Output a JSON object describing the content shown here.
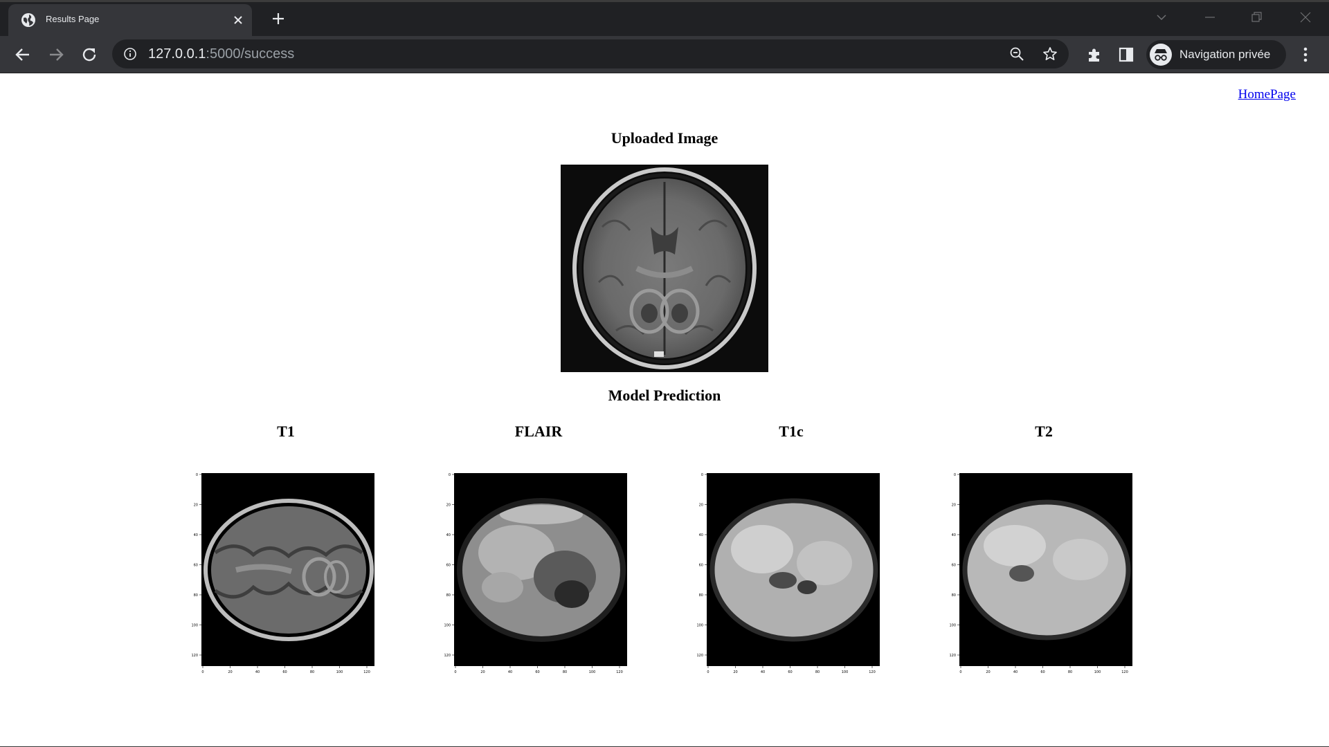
{
  "browser": {
    "tab_title": "Results Page",
    "url_host": "127.0.0.1",
    "url_path": ":5000/success",
    "profile_label": "Navigation privée"
  },
  "page": {
    "home_link": "HomePage",
    "uploaded_title": "Uploaded Image",
    "prediction_title": "Model Prediction",
    "modalities": [
      "T1",
      "FLAIR",
      "T1c",
      "T2"
    ],
    "y_ticks": [
      "0",
      "20",
      "40",
      "60",
      "80",
      "100",
      "120"
    ],
    "x_ticks": [
      "0",
      "20",
      "40",
      "60",
      "80",
      "100",
      "120"
    ]
  },
  "icons": {
    "favicon": "globe-icon",
    "close": "close-icon",
    "new_tab": "plus-icon",
    "back": "arrow-left-icon",
    "forward": "arrow-right-icon",
    "reload": "reload-icon",
    "info": "info-icon",
    "zoom": "zoom-out-icon",
    "bookmark": "star-icon",
    "extensions": "puzzle-icon",
    "side_panel": "side-panel-icon",
    "incognito": "incognito-icon",
    "menu": "kebab-menu-icon"
  }
}
